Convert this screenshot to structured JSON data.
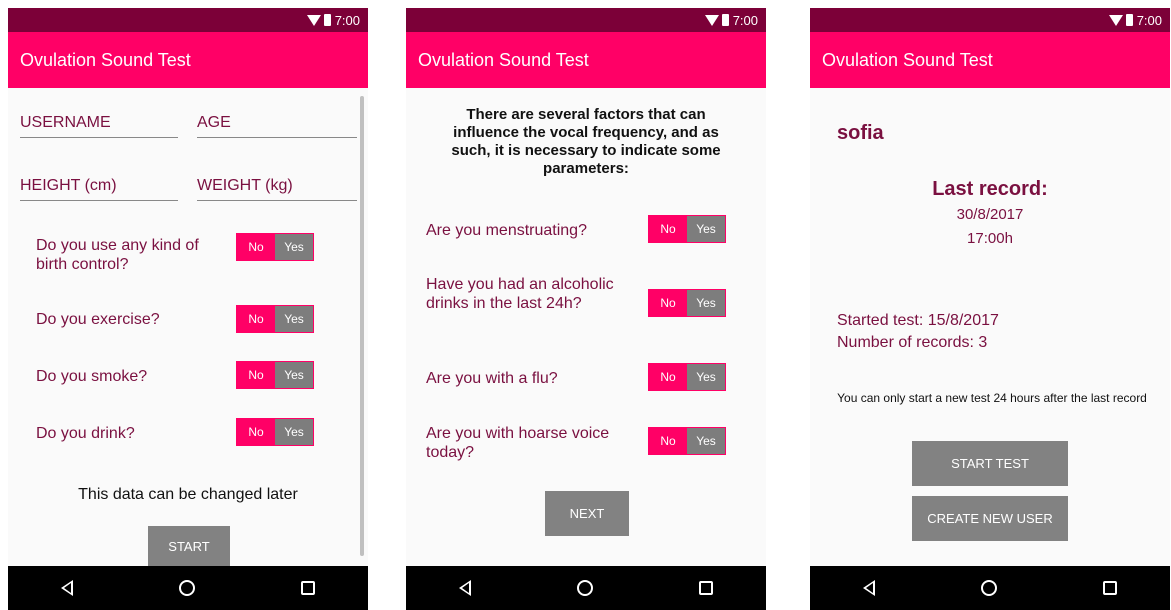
{
  "status": {
    "time": "7:00"
  },
  "app_title": "Ovulation Sound Test",
  "screen1": {
    "username_placeholder": "USERNAME",
    "age_placeholder": "AGE",
    "height_placeholder": "HEIGHT (cm)",
    "weight_placeholder": "WEIGHT (kg)",
    "questions": [
      {
        "label": "Do you use any kind of birth control?",
        "no": "No",
        "yes": "Yes"
      },
      {
        "label": "Do you exercise?",
        "no": "No",
        "yes": "Yes"
      },
      {
        "label": "Do you smoke?",
        "no": "No",
        "yes": "Yes"
      },
      {
        "label": "Do you drink?",
        "no": "No",
        "yes": "Yes"
      }
    ],
    "note": "This data can be changed later",
    "start_label": "START"
  },
  "screen2": {
    "intro": "There are several factors that can influence the vocal frequency, and as such, it is necessary to indicate some parameters:",
    "questions": [
      {
        "label": "Are you menstruating?",
        "no": "No",
        "yes": "Yes"
      },
      {
        "label": "Have you had an alcoholic drinks in the last 24h?",
        "no": "No",
        "yes": "Yes"
      },
      {
        "label": "Are you with a flu?",
        "no": "No",
        "yes": "Yes"
      },
      {
        "label": "Are you with hoarse voice today?",
        "no": "No",
        "yes": "Yes"
      }
    ],
    "next_label": "NEXT"
  },
  "screen3": {
    "username": "sofia",
    "last_record_title": "Last record:",
    "last_record_date": "30/8/2017",
    "last_record_time": "17:00h",
    "started_test": "Started test:  15/8/2017",
    "number_of_records": "Number of records:  3",
    "notice": "You can only start a new test 24 hours after the last record",
    "start_test_label": "START TEST",
    "create_user_label": "CREATE NEW USER"
  },
  "colors": {
    "status_bar": "#7c0038",
    "app_bar": "#ff0066",
    "label": "#7a1040",
    "button": "#828282"
  }
}
